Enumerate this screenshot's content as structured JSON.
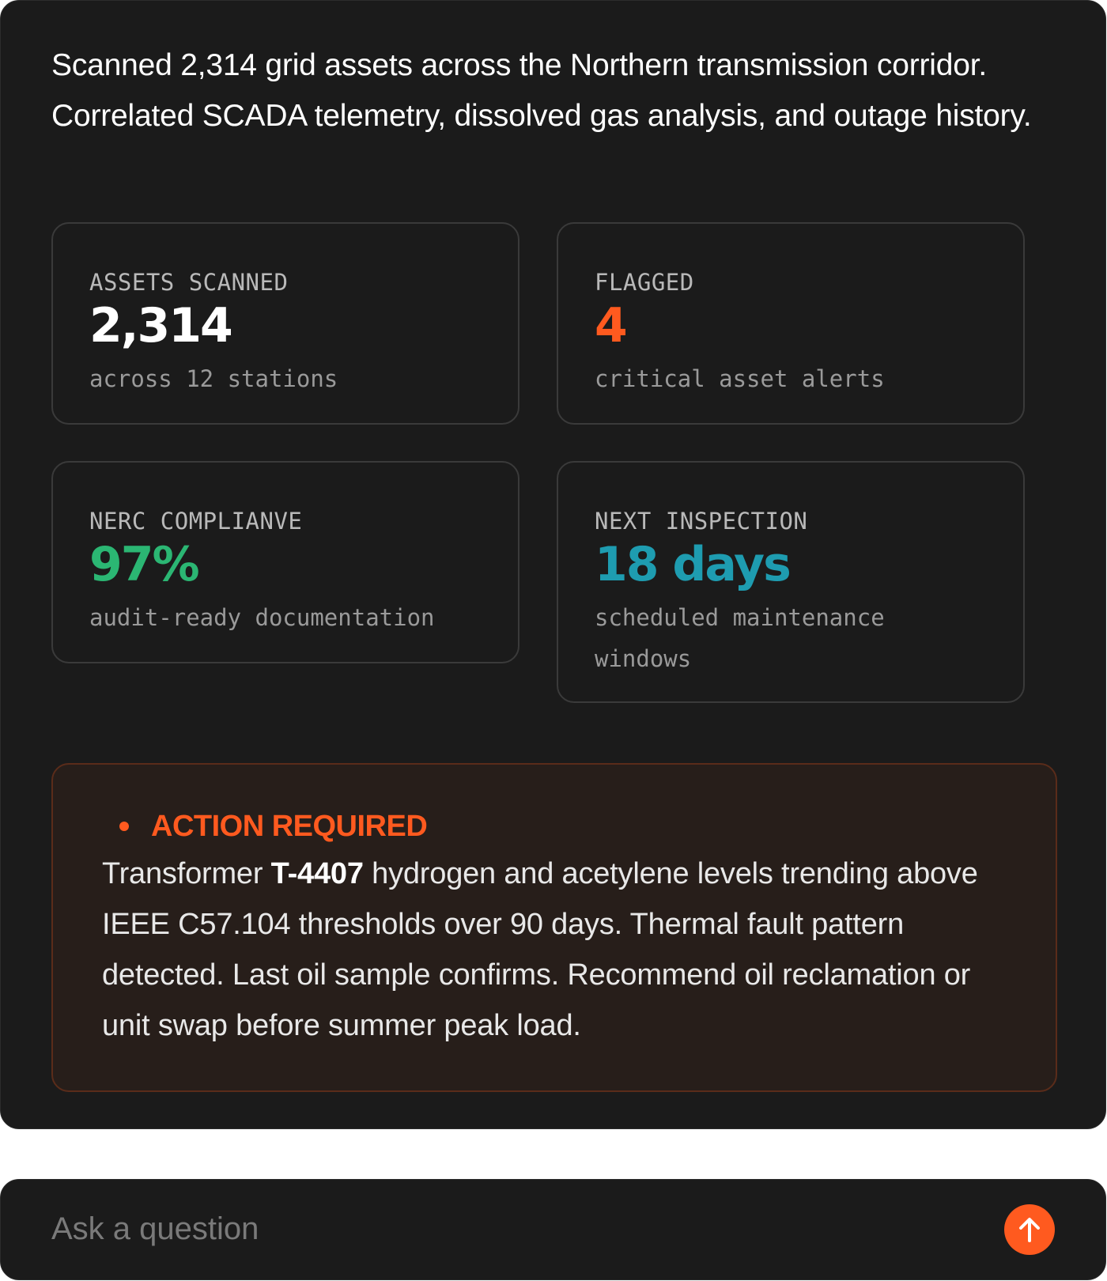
{
  "summary": {
    "line1": "Scanned 2,314 grid assets across the Northern transmission corridor.",
    "line2": "Correlated SCADA telemetry, dissolved gas analysis, and outage history."
  },
  "colors": {
    "accent_orange": "#ff5a1f",
    "success_green": "#2bb673",
    "info_teal": "#1e9cb0"
  },
  "stats": [
    {
      "label": "ASSETS SCANNED",
      "value": "2,314",
      "sub": "across 12 stations",
      "color": "#ffffff"
    },
    {
      "label": "FLAGGED",
      "value": "4",
      "sub": "critical asset alerts",
      "color": "#ff5a1f"
    },
    {
      "label": "NERC COMPLIANVE",
      "value": "97%",
      "sub": "audit-ready documentation",
      "color": "#2bb673"
    },
    {
      "label": "NEXT INSPECTION",
      "value": "18 days",
      "sub": "scheduled maintenance windows",
      "color": "#1e9cb0"
    }
  ],
  "alert": {
    "title": "ACTION REQUIRED",
    "body_prefix": "Transformer ",
    "asset_id": "T-4407",
    "body_suffix": " hydrogen and acetylene levels trending above IEEE C57.104 thresholds over 90 days. Thermal fault pattern detected. Last oil sample confirms. Recommend oil reclamation or unit swap before summer peak load."
  },
  "ask": {
    "placeholder": "Ask a question",
    "send_icon": "arrow-up-icon"
  }
}
